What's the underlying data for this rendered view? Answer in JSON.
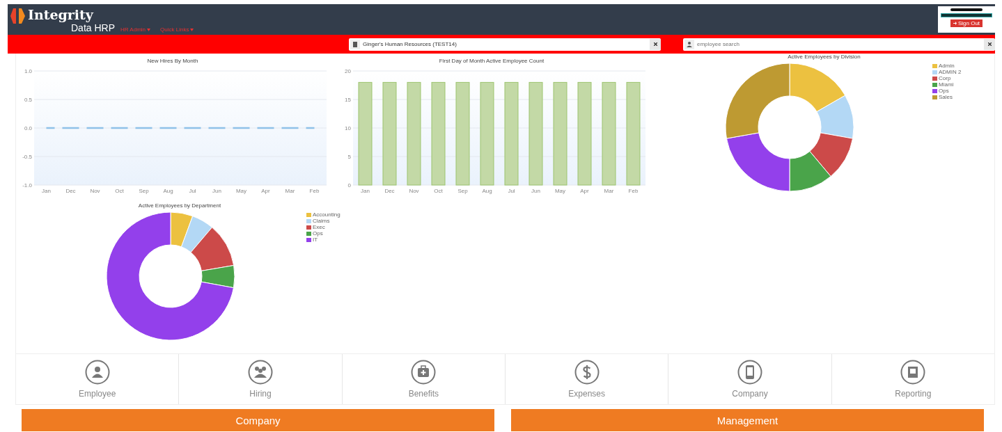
{
  "header": {
    "logo_title": "Integrity",
    "logo_subtitle": "Data HRP",
    "nav": [
      {
        "label": "HR Admin"
      },
      {
        "label": "Quick Links"
      }
    ],
    "sign_out": "Sign Out"
  },
  "toolbar": {
    "company_select": {
      "value": "Ginger's Human Resources (TEST14)"
    },
    "employee_search": {
      "placeholder": "employee search"
    }
  },
  "charts": [
    {
      "chart_data": {
        "type": "line",
        "title": "New Hires By Month",
        "categories": [
          "Jan",
          "Dec",
          "Nov",
          "Oct",
          "Sep",
          "Aug",
          "Jul",
          "Jun",
          "May",
          "Apr",
          "Mar",
          "Feb"
        ],
        "series": [
          {
            "color": "#8fc1e8",
            "line_style": "dashed",
            "values": [
              0,
              0,
              0,
              0,
              0,
              0,
              0,
              0,
              0,
              0,
              0,
              0
            ]
          }
        ],
        "grid": true,
        "ylim": [
          -1,
          1
        ],
        "yticks": [
          {
            "value": -1,
            "label": "-1.0"
          },
          {
            "value": -0.5,
            "label": "-0.5"
          },
          {
            "value": 0,
            "label": "0.0"
          },
          {
            "value": 0.5,
            "label": "0.5"
          },
          {
            "value": 1,
            "label": "1.0"
          }
        ]
      }
    },
    {
      "chart_data": {
        "type": "bar",
        "title": "First Day of Month Active Employee Count",
        "categories": [
          "Jan",
          "Dec",
          "Nov",
          "Oct",
          "Sep",
          "Aug",
          "Jul",
          "Jun",
          "May",
          "Apr",
          "Mar",
          "Feb"
        ],
        "series": [
          {
            "color": "#c3d9a6",
            "values": [
              18,
              18,
              18,
              18,
              18,
              18,
              18,
              18,
              18,
              18,
              18,
              18
            ]
          }
        ],
        "grid": true,
        "ylim": [
          0,
          20
        ],
        "yticks": [
          0,
          5,
          10,
          15,
          20
        ]
      }
    },
    {
      "chart_data": {
        "type": "donut",
        "title": "Active Employees by Division",
        "categories": [
          "Admin",
          "ADMIN 2",
          "Corp",
          "Miami",
          "Ops",
          "Sales"
        ],
        "values": [
          16.7,
          11.1,
          11.1,
          11.1,
          22.2,
          27.8
        ],
        "legend": "right",
        "colors": [
          "#ecc140",
          "#b3d8f5",
          "#cc4a49",
          "#4aa44a",
          "#9340eb",
          "#be9a32"
        ]
      }
    },
    {
      "chart_data": {
        "type": "donut",
        "title": "Active Employees by Department",
        "categories": [
          "Accounting",
          "Claims",
          "Exec",
          "Ops",
          "IT"
        ],
        "values": [
          5.6,
          5.6,
          11.1,
          5.6,
          72.1
        ],
        "legend": "right",
        "colors": [
          "#ecc140",
          "#b3d8f5",
          "#cc4a49",
          "#4aa44a",
          "#9340eb"
        ]
      }
    }
  ],
  "modules": [
    {
      "label": "Employee"
    },
    {
      "label": "Hiring"
    },
    {
      "label": "Benefits"
    },
    {
      "label": "Expenses"
    },
    {
      "label": "Company"
    },
    {
      "label": "Reporting"
    }
  ],
  "bottom_buttons": [
    {
      "label": "Company"
    },
    {
      "label": "Management"
    }
  ]
}
